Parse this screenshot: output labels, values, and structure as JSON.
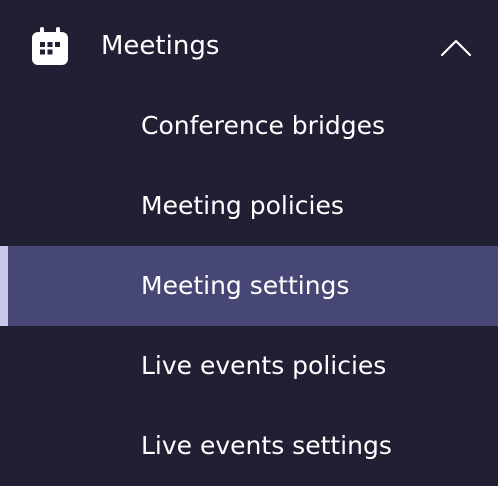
{
  "nav": {
    "group": {
      "label": "Meetings",
      "icon": "calendar-icon",
      "expanded": true,
      "chevron_icon": "chevron-up-icon"
    },
    "items": [
      {
        "label": "Conference bridges",
        "selected": false
      },
      {
        "label": "Meeting policies",
        "selected": false
      },
      {
        "label": "Meeting settings",
        "selected": true
      },
      {
        "label": "Live events policies",
        "selected": false
      },
      {
        "label": "Live events settings",
        "selected": false
      }
    ]
  },
  "colors": {
    "background": "#201f33",
    "selected_background": "#464775",
    "selected_indicator": "#c8c7ea",
    "text": "#ffffff"
  }
}
